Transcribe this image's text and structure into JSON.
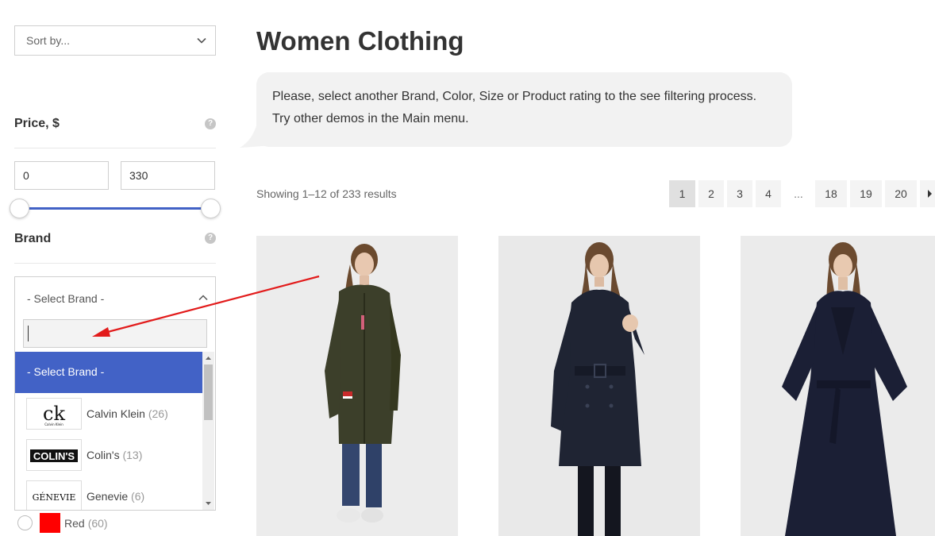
{
  "sidebar": {
    "sort": {
      "label": "Sort by...",
      "icon": "chevron-down-icon"
    },
    "price": {
      "title": "Price, $",
      "help": "?",
      "min_value": "0",
      "max_value": "330",
      "slider_accent": "#4262c6"
    },
    "brand": {
      "title": "Brand",
      "help": "?",
      "selected": "- Select Brand -",
      "search_value": "",
      "options": [
        {
          "label": "- Select Brand -",
          "highlighted": true
        },
        {
          "label": "Calvin Klein",
          "count": "(26)",
          "logo_text": "ck",
          "logo_sub": "Calvin Klein"
        },
        {
          "label": "Colin's",
          "count": "(13)",
          "logo_text": "COLIN'S"
        },
        {
          "label": "Genevie",
          "count": "(6)",
          "logo_text": "GÉNEVIE"
        }
      ]
    },
    "color_filter": {
      "name": "Red",
      "count": "(60)",
      "swatch": "#ff0000"
    }
  },
  "main": {
    "title": "Women Clothing",
    "notice": {
      "line1": "Please, select another Brand, Color, Size or Product rating to the see filtering process.",
      "line2": "Try other demos in the Main menu."
    },
    "result_count": "Showing 1–12 of 233 results",
    "pagination": {
      "pages": [
        "1",
        "2",
        "3",
        "4",
        "18",
        "19",
        "20"
      ],
      "ellipsis": "...",
      "current": "1",
      "next_icon": "caret-right-icon"
    },
    "products": [
      {
        "name": "olive-parka-model",
        "coat_color": "#3c3f2a"
      },
      {
        "name": "navy-trench-coat-model",
        "coat_color": "#1f2433"
      },
      {
        "name": "navy-wrap-coat-model",
        "coat_color": "#1b1f35"
      }
    ]
  },
  "annotation": {
    "arrow_color": "#e21b1b"
  },
  "colors": {
    "accent": "#4262c6",
    "notice_bg": "#f2f2f2",
    "border": "#cfcfcf"
  }
}
